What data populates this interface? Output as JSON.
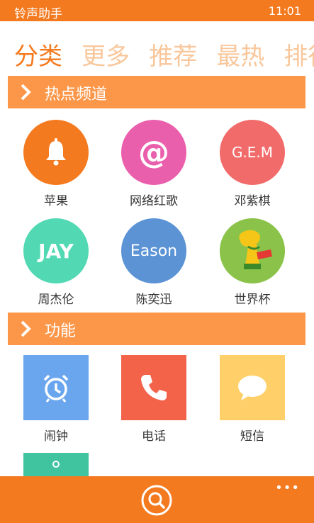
{
  "status": {
    "app_name": "铃声助手",
    "time": "11:01"
  },
  "pivot": {
    "tabs": [
      "分类",
      "更多",
      "推荐",
      "最热",
      "排行"
    ]
  },
  "hot_channels": {
    "title": "热点频道",
    "items": [
      {
        "label": "苹果",
        "icon": "bell-icon",
        "color": "#f47a20"
      },
      {
        "label": "网络红歌",
        "icon": "at-icon",
        "icon_text": "@",
        "color": "#ea5fac"
      },
      {
        "label": "邓紫棋",
        "icon_text": "G.E.M",
        "color": "#f26b6b"
      },
      {
        "label": "周杰伦",
        "icon_text": "JAY",
        "color": "#52d9b3"
      },
      {
        "label": "陈奕迅",
        "icon_text": "Eason",
        "color": "#5b93d5"
      },
      {
        "label": "世界杯",
        "icon": "world-cup-trophy-icon",
        "color": "#8bc34a"
      }
    ]
  },
  "features": {
    "title": "功能",
    "items": [
      {
        "label": "闹钟",
        "icon": "alarm-clock-icon",
        "color": "#6aa6ee"
      },
      {
        "label": "电话",
        "icon": "phone-icon",
        "color": "#f2634a"
      },
      {
        "label": "短信",
        "icon": "speech-bubble-icon",
        "color": "#ffd06a"
      },
      {
        "label": "",
        "icon": "partial-tile",
        "color": "#40c4a0"
      }
    ]
  },
  "bottom": {
    "more": "•••"
  }
}
